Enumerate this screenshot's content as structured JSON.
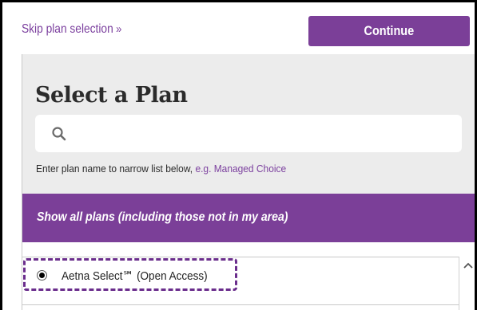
{
  "header": {
    "skip_link": "Skip plan selection",
    "skip_chevrons": "»",
    "continue_label": "Continue"
  },
  "select_panel": {
    "title": "Select a Plan",
    "search_placeholder": "",
    "helper_text": "Enter plan name to narrow list below, ",
    "helper_example": "e.g. Managed Choice"
  },
  "filter_band": {
    "show_all_label": "Show all plans (including those not in my area)"
  },
  "plans": [
    {
      "label": "Aetna Select℠ (Open Access)",
      "selected": true
    }
  ],
  "colors": {
    "brand_purple": "#7b3f98",
    "panel_gray": "#ececec",
    "focus_outline": "#6a2d8c"
  },
  "icons": {
    "search": "search-icon",
    "scroll_up": "chevron-up-icon",
    "radio": "radio-selected-icon"
  }
}
